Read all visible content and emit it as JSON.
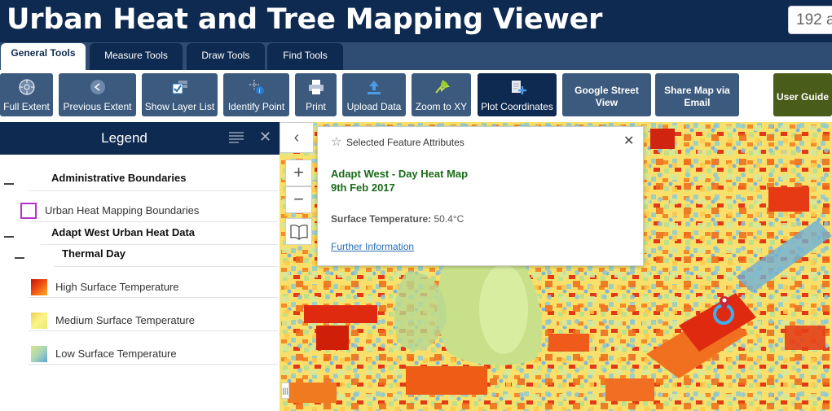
{
  "header": {
    "title": "Urban Heat and Tree Mapping Viewer",
    "search_value": "192 a"
  },
  "tabs": [
    {
      "label": "General Tools",
      "active": true
    },
    {
      "label": "Measure Tools"
    },
    {
      "label": "Draw Tools"
    },
    {
      "label": "Find Tools"
    }
  ],
  "toolbar": {
    "full_extent": "Full Extent",
    "previous_extent": "Previous Extent",
    "show_layer_list": "Show Layer List",
    "identify_point": "Identify Point",
    "print": "Print",
    "upload_data": "Upload Data",
    "zoom_to_xy": "Zoom to XY",
    "plot_coordinates": "Plot Coordinates",
    "google_street_view_1": "Google Street",
    "google_street_view_2": "View",
    "share_map_1": "Share Map via",
    "share_map_2": "Email",
    "user_guide": "User Guide"
  },
  "legend": {
    "title": "Legend",
    "admin_group": "Administrative Boundaries",
    "boundary_item": "Urban Heat Mapping Boundaries",
    "heat_group": "Adapt West Urban Heat Data",
    "thermal_group": "Thermal Day",
    "high": "High Surface Temperature",
    "medium": "Medium Surface Temperature",
    "low": "Low Surface Temperature"
  },
  "popup": {
    "header": "Selected Feature Attributes",
    "feature_line1": "Adapt West - Day Heat Map",
    "feature_line2": "9th Feb 2017",
    "temp_label": "Surface Temperature:",
    "temp_value": "50.4",
    "temp_unit": "°C",
    "link": "Further Information"
  },
  "colors": {
    "header_bg": "#0e2a50",
    "tab_bg": "#2f4d72",
    "button_bg": "#3b5a7e",
    "guide_bg": "#4a5c1a",
    "feature_green": "#1a6b1a",
    "boundary_purple": "#b532c9"
  }
}
